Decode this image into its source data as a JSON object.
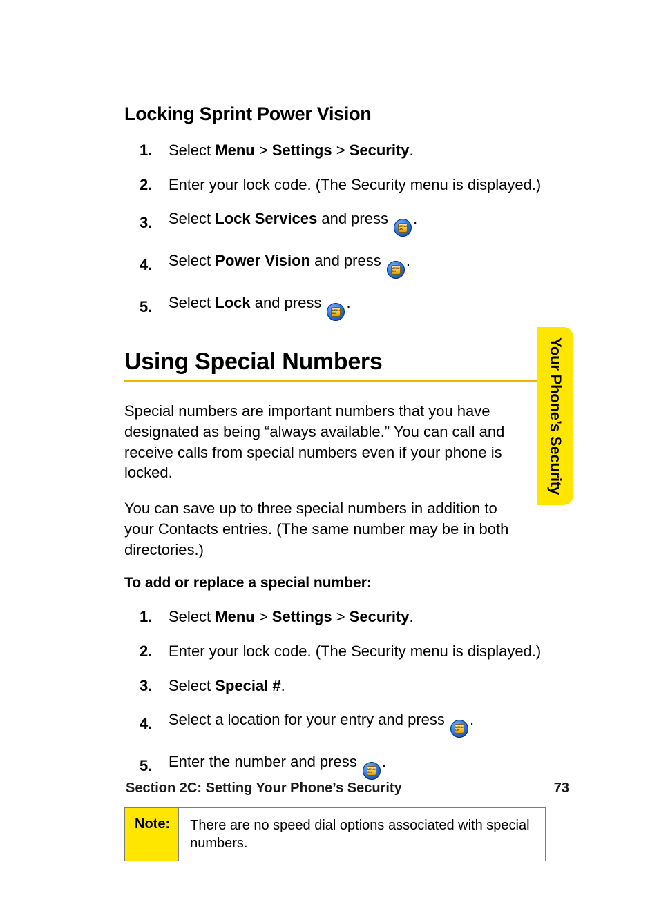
{
  "subheading": "Locking Sprint Power Vision",
  "steps_a": [
    {
      "num": "1.",
      "pre": "Select ",
      "b1": "Menu",
      "s1": " > ",
      "b2": "Settings",
      "s2": " > ",
      "b3": "Security",
      "post": "."
    },
    {
      "num": "2.",
      "text": "Enter your lock code. (The Security menu is displayed.)"
    },
    {
      "num": "3.",
      "pre": "Select ",
      "b1": "Lock Services",
      "post": " and press ",
      "btn": true,
      "tail": "."
    },
    {
      "num": "4.",
      "pre": "Select ",
      "b1": "Power Vision",
      "post": " and press ",
      "btn": true,
      "tail": "."
    },
    {
      "num": "5.",
      "pre": "Select ",
      "b1": "Lock",
      "post": " and press ",
      "btn": true,
      "tail": "."
    }
  ],
  "section_title": "Using Special Numbers",
  "para1": "Special numbers are important numbers that you have designated as being “always available.” You can call and receive calls from special numbers even if your phone is locked.",
  "para2": "You can save up to three special numbers in addition to your Contacts entries. (The same number may be in both directories.)",
  "lead_in": "To add or replace a special number:",
  "steps_b": [
    {
      "num": "1.",
      "pre": "Select ",
      "b1": "Menu",
      "s1": " > ",
      "b2": "Settings",
      "s2": " > ",
      "b3": "Security",
      "post": "."
    },
    {
      "num": "2.",
      "text": "Enter your lock code. (The Security menu is displayed.)"
    },
    {
      "num": "3.",
      "pre": "Select ",
      "b1": "Special #",
      "post": "."
    },
    {
      "num": "4.",
      "text_pre": "Select a location for your entry and press ",
      "btn": true,
      "tail": "."
    },
    {
      "num": "5.",
      "text_pre": "Enter the number and press ",
      "btn": true,
      "tail": "."
    }
  ],
  "note_label": "Note:",
  "note_text": "There are no speed dial options associated with special numbers.",
  "side_tab": "Your Phone’s Security",
  "footer_left": "Section 2C: Setting Your Phone’s Security",
  "footer_right": "73",
  "btn_label": "MENU OK"
}
